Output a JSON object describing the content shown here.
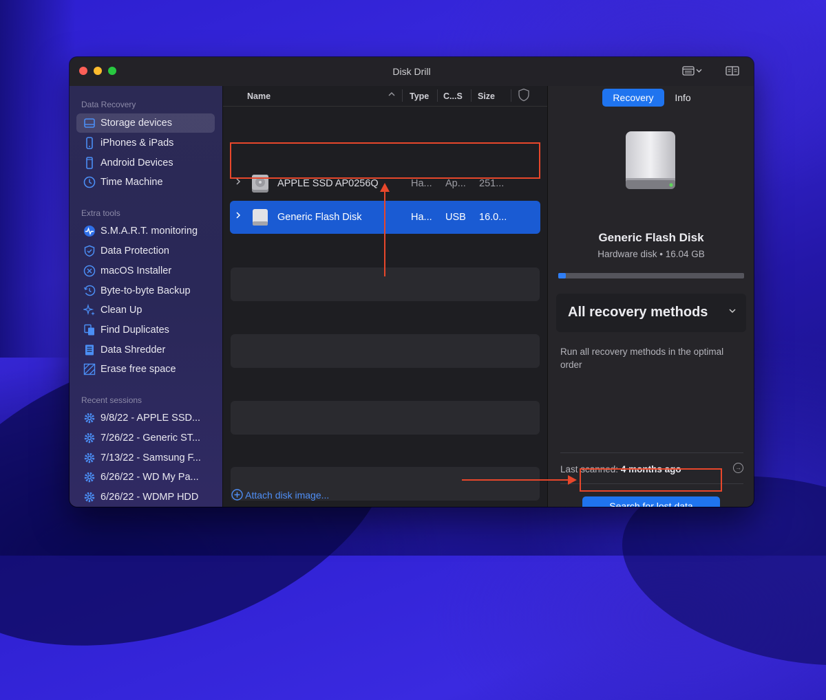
{
  "window": {
    "title": "Disk Drill"
  },
  "sidebar": {
    "sections": [
      {
        "title": "Data Recovery"
      },
      {
        "title": "Extra tools"
      },
      {
        "title": "Recent sessions"
      }
    ],
    "data_recovery": [
      {
        "label": "Storage devices",
        "icon": "drive-icon",
        "active": true
      },
      {
        "label": "iPhones & iPads",
        "icon": "iphone-icon"
      },
      {
        "label": "Android Devices",
        "icon": "android-phone-icon"
      },
      {
        "label": "Time Machine",
        "icon": "time-machine-icon"
      }
    ],
    "extra_tools": [
      {
        "label": "S.M.A.R.T. monitoring",
        "icon": "pulse-icon"
      },
      {
        "label": "Data Protection",
        "icon": "shield-icon"
      },
      {
        "label": "macOS Installer",
        "icon": "macos-installer-icon"
      },
      {
        "label": "Byte-to-byte Backup",
        "icon": "backup-clock-icon"
      },
      {
        "label": "Clean Up",
        "icon": "sparkle-icon"
      },
      {
        "label": "Find Duplicates",
        "icon": "duplicates-icon"
      },
      {
        "label": "Data Shredder",
        "icon": "shredder-icon"
      },
      {
        "label": "Erase free space",
        "icon": "erase-icon"
      }
    ],
    "recent_sessions": [
      {
        "label": "9/8/22 - APPLE SSD..."
      },
      {
        "label": "7/26/22 - Generic ST..."
      },
      {
        "label": "7/13/22 - Samsung F..."
      },
      {
        "label": "6/26/22 - WD My Pa..."
      },
      {
        "label": "6/26/22 - WDMP HDD"
      }
    ]
  },
  "device_list": {
    "columns": {
      "name": "Name",
      "type": "Type",
      "cs": "C...S",
      "size": "Size"
    },
    "rows": [
      {
        "name": "APPLE SSD AP0256Q",
        "type": "Ha...",
        "cs": "Ap...",
        "size": "251..."
      },
      {
        "name": "Generic Flash Disk",
        "type": "Ha...",
        "cs": "USB",
        "size": "16.0...",
        "selected": true
      }
    ],
    "attach_label": "Attach disk image..."
  },
  "details": {
    "tabs": [
      "Recovery",
      "Info"
    ],
    "disk_name": "Generic Flash Disk",
    "disk_subtitle": "Hardware disk • 16.04 GB",
    "used_fraction": 0.04,
    "method_label": "All recovery methods",
    "method_description": "Run all recovery methods in the optimal order",
    "last_scanned_label": "Last scanned:",
    "last_scanned_value": "4 months ago",
    "search_button": "Search for lost data"
  },
  "colors": {
    "accent": "#1f74ef",
    "selection": "#1a5bd3",
    "annotation": "#e8472b"
  }
}
